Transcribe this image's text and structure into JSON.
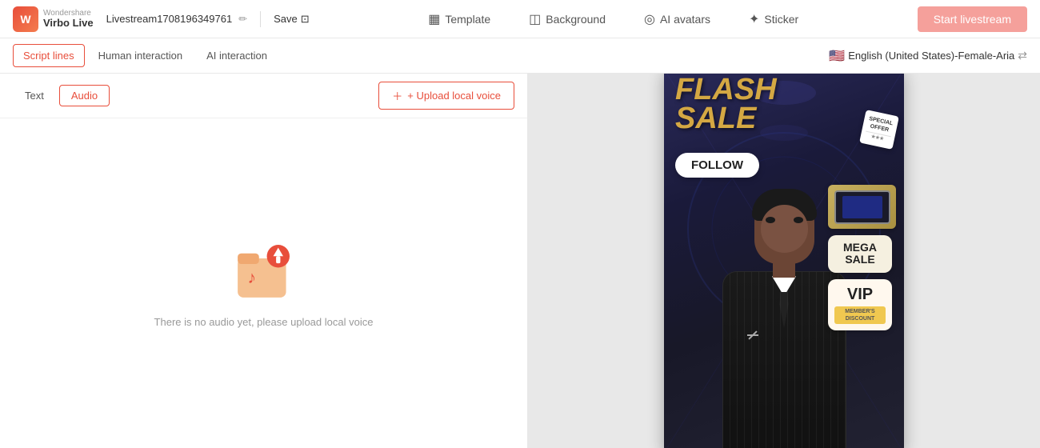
{
  "app": {
    "logo_brand": "Wondershare",
    "logo_product": "Virbo Live",
    "project_name": "Livestream1708196349761",
    "save_label": "Save"
  },
  "top_nav": {
    "template_label": "Template",
    "background_label": "Background",
    "ai_avatars_label": "AI avatars",
    "sticker_label": "Sticker",
    "start_livestream_label": "Start livestream"
  },
  "secondary_nav": {
    "tabs": [
      {
        "id": "script-lines",
        "label": "Script lines",
        "active": true
      },
      {
        "id": "human-interaction",
        "label": "Human interaction",
        "active": false
      },
      {
        "id": "ai-interaction",
        "label": "AI interaction",
        "active": false
      }
    ],
    "language_selector": "English (United States)-Female-Aria"
  },
  "sub_tabs": [
    {
      "id": "text",
      "label": "Text",
      "active": false
    },
    {
      "id": "audio",
      "label": "Audio",
      "active": true
    }
  ],
  "upload_button": "+ Upload local voice",
  "empty_state": {
    "message": "There is no audio yet, please upload local voice"
  },
  "preview": {
    "flash_sale_line1": "FLASH",
    "flash_sale_line2": "SALE",
    "follow_label": "FOLLOW",
    "mega_sale_line1": "MEGA",
    "mega_sale_line2": "SALE",
    "vip_label": "VIP",
    "members_discount": "MEMBER'S\nDISCOUNT",
    "special_offer_label": "SPECIAL\nOFFER"
  },
  "icons": {
    "edit": "✏",
    "save": "⊡",
    "template_icon": "▦",
    "background_icon": "◫",
    "ai_avatars_icon": "◎",
    "sticker_icon": "◉",
    "swap_arrows": "⇄",
    "upload_plus": "+",
    "arrow_up": "↑",
    "music_note": "♪"
  }
}
